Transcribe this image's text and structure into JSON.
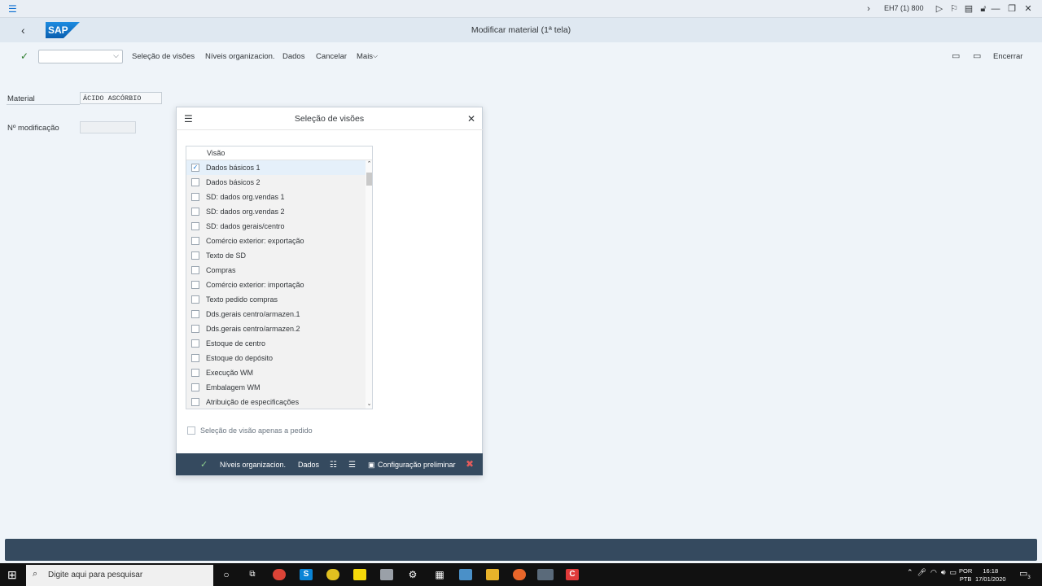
{
  "app": {
    "system_id": "EH7 (1) 800",
    "title": "Modificar material (1ª tela)",
    "logo_text": "SAP"
  },
  "toolbar": {
    "buttons": [
      "Seleção de visões",
      "Níveis organizacion.",
      "Dados",
      "Cancelar",
      "Mais"
    ],
    "exit": "Encerrar"
  },
  "form": {
    "material_label": "Material",
    "material_value": "ÁCIDO ASCÓRBIO",
    "modification_label": "Nº modificação",
    "modification_value": ""
  },
  "dialog": {
    "title": "Seleção de visões",
    "column_header": "Visão",
    "rows": [
      {
        "label": "Dados básicos 1",
        "checked": true
      },
      {
        "label": "Dados básicos 2",
        "checked": false
      },
      {
        "label": "SD: dados org.vendas 1",
        "checked": false
      },
      {
        "label": "SD: dados org.vendas 2",
        "checked": false
      },
      {
        "label": "SD: dados gerais/centro",
        "checked": false
      },
      {
        "label": "Comércio exterior: exportação",
        "checked": false
      },
      {
        "label": "Texto de SD",
        "checked": false
      },
      {
        "label": "Compras",
        "checked": false
      },
      {
        "label": "Comércio exterior: importação",
        "checked": false
      },
      {
        "label": "Texto pedido compras",
        "checked": false
      },
      {
        "label": "Dds.gerais centro/armazen.1",
        "checked": false
      },
      {
        "label": "Dds.gerais centro/armazen.2",
        "checked": false
      },
      {
        "label": "Estoque de centro",
        "checked": false
      },
      {
        "label": "Estoque do depósito",
        "checked": false
      },
      {
        "label": "Execução WM",
        "checked": false
      },
      {
        "label": "Embalagem WM",
        "checked": false
      },
      {
        "label": "Atribuição de especificações",
        "checked": false
      }
    ],
    "option_label": "Seleção de visão apenas a pedido",
    "footer": {
      "org_levels": "Níveis organizacion.",
      "data": "Dados",
      "default_settings": "Configuração preliminar"
    }
  },
  "taskbar": {
    "search_placeholder": "Digite aqui para pesquisar",
    "language": "POR",
    "language_sub": "PTB",
    "time": "16:18",
    "date": "17/01/2020",
    "notifications": "3"
  },
  "colors": {
    "accent": "#0a6ed1",
    "footer_bg": "#354a5f",
    "shell_bg": "#dfe8f1",
    "page_bg": "#eff4f9"
  }
}
